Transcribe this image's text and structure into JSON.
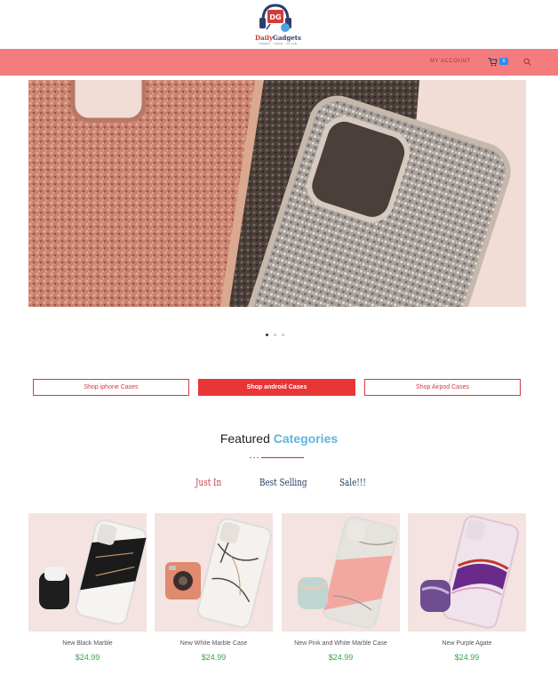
{
  "header": {
    "logo_text_part1": "Daily",
    "logo_text_part2": "Gadgets",
    "logo_tagline": "SMART · SAFE · STYLE",
    "logo_badge": "DG"
  },
  "nav": {
    "account_label": "MY ACCOUNT",
    "cart_count": "0"
  },
  "carousel": {
    "slide_count": 3,
    "active_slide": 1
  },
  "shop_buttons": [
    {
      "label": "Shop iphone Cases"
    },
    {
      "label": "Shop android Cases"
    },
    {
      "label": "Shop Airpod Cases"
    }
  ],
  "section": {
    "title_part1": "Featured",
    "title_part2": "Categories"
  },
  "filter_tabs": [
    {
      "label": "Just In"
    },
    {
      "label": "Best Selling"
    },
    {
      "label": "Sale!!!"
    }
  ],
  "products": [
    {
      "name": "New Black Marble",
      "price": "$24.99"
    },
    {
      "name": "New White Marble Case",
      "price": "$24.99"
    },
    {
      "name": "New Pink and White Marble Case",
      "price": "$24.99"
    },
    {
      "name": "New Purple Agate",
      "price": "$24.99"
    }
  ],
  "colors": {
    "navbar": "#f47c7c",
    "accent_red": "#e83535",
    "accent_blue": "#5fb4dc",
    "price_green": "#3aa34a",
    "cart_badge": "#2d8cf0"
  }
}
